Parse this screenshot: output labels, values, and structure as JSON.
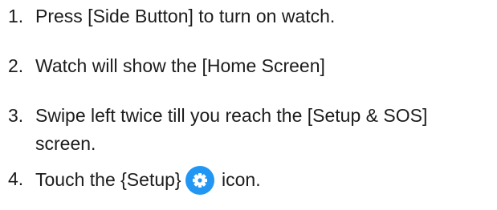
{
  "steps": [
    {
      "number": "1.",
      "text": "Press [Side Button] to turn on watch."
    },
    {
      "number": "2.",
      "text": "Watch will show the [Home Screen]"
    },
    {
      "number": "3.",
      "text": "Swipe left twice till you reach the [Setup & SOS] screen."
    },
    {
      "number": "4.",
      "text_before": "Touch the {Setup}",
      "icon": "gear-icon",
      "text_after": "icon."
    }
  ],
  "colors": {
    "text": "#1c1c1c",
    "icon_background": "#2196f3",
    "icon_glyph": "#ffffff"
  }
}
